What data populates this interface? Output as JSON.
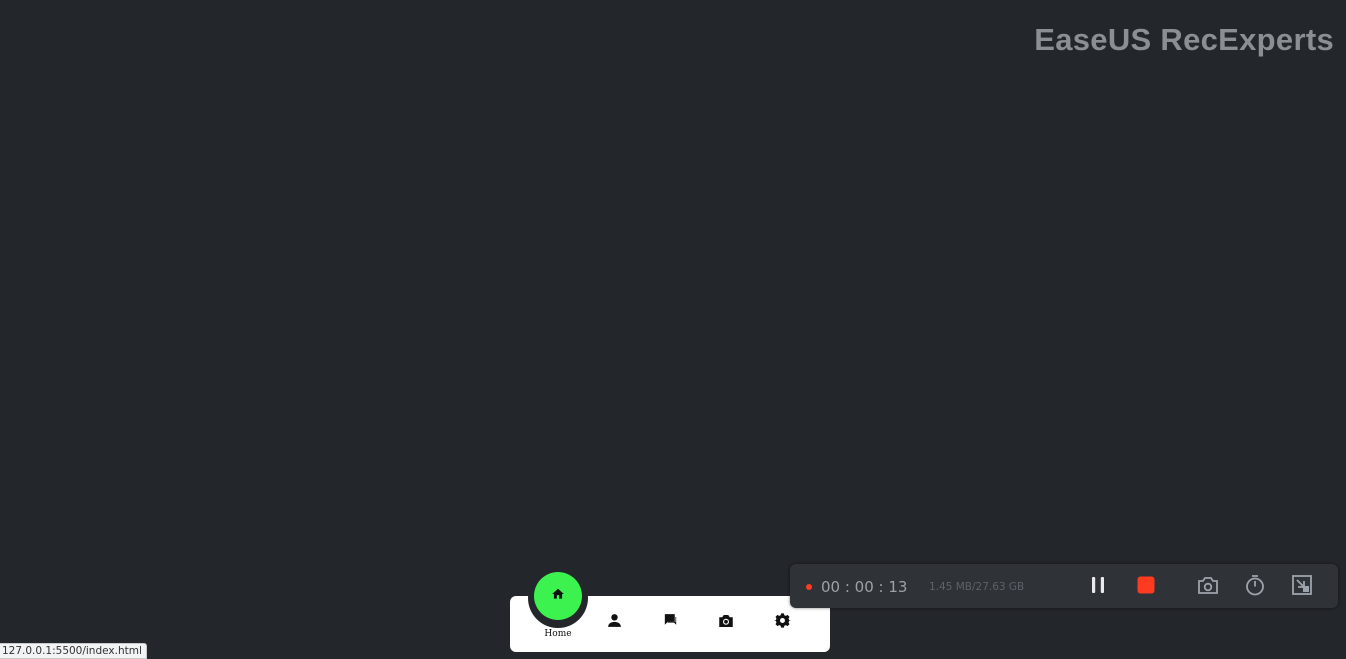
{
  "watermark": "EaseUS RecExperts",
  "nav": {
    "items": [
      {
        "id": "home",
        "icon": "home-icon",
        "label": "Home",
        "active": true
      },
      {
        "id": "profile",
        "icon": "person-icon"
      },
      {
        "id": "messages",
        "icon": "chat-icon"
      },
      {
        "id": "camera",
        "icon": "camera-icon"
      },
      {
        "id": "settings",
        "icon": "gear-icon"
      }
    ],
    "active_color": "#3cf24f"
  },
  "recorder": {
    "elapsed": "00 : 00 : 13",
    "size": "1.45 MB/27.63 GB",
    "status_color": "#ff3b1f",
    "controls": [
      "pause-icon",
      "stop-icon",
      "screenshot-icon",
      "timer-icon",
      "minimize-icon"
    ]
  },
  "status_bar": {
    "url": "127.0.0.1:5500/index.html"
  }
}
